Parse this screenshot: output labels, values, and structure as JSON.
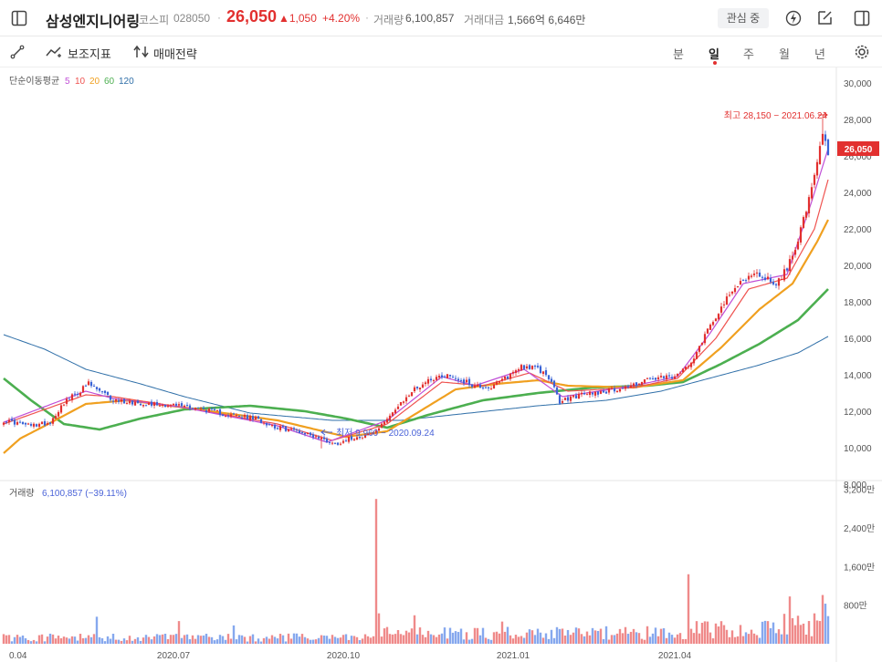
{
  "header": {
    "stock_name": "삼성엔지니어링",
    "market": "코스피",
    "code": "028050",
    "price": "26,050",
    "change": "▲1,050",
    "change_pct": "+4.20%",
    "volume_label": "거래량",
    "volume_value": "6,100,857",
    "amount_label": "거래대금",
    "amount_value": "1,566억 6,646만",
    "watch_label": "관심 중",
    "up_color": "#e2302f"
  },
  "toolbar": {
    "indicator_label": "보조지표",
    "strategy_label": "매매전략",
    "periods": [
      "분",
      "일",
      "주",
      "월",
      "년"
    ],
    "active_period": "일"
  },
  "chart_data": {
    "type": "candlestick",
    "ma_label": "단순이동평균",
    "ma_periods": [
      {
        "label": "5",
        "color": "#c04fd6"
      },
      {
        "label": "10",
        "color": "#ef5350"
      },
      {
        "label": "20",
        "color": "#f0a020"
      },
      {
        "label": "60",
        "color": "#4caf50"
      },
      {
        "label": "120",
        "color": "#2f6fa8"
      }
    ],
    "price_axis": {
      "ylim": [
        7000,
        31000
      ],
      "ticks": [
        "30,000",
        "28,000",
        "26,000",
        "24,000",
        "22,000",
        "20,000",
        "18,000",
        "16,000",
        "14,000",
        "12,000",
        "10,000",
        "8,000"
      ],
      "tick_values": [
        30000,
        28000,
        26000,
        24000,
        22000,
        20000,
        18000,
        16000,
        14000,
        12000,
        10000,
        8000
      ]
    },
    "x_labels": [
      {
        "label": "0.04",
        "i": 2
      },
      {
        "label": "2020.07",
        "i": 62
      },
      {
        "label": "2020.10",
        "i": 124
      },
      {
        "label": "2021.01",
        "i": 186
      },
      {
        "label": "2021.04",
        "i": 245
      }
    ],
    "current_price_tag": "26,050",
    "current_price": 26050,
    "high_annotation": "최고 28,150 − 2021.06.24",
    "high": 28150,
    "low_annotation": "최저 9,960 − 2020.09.24",
    "low": 9960,
    "close_series": [
      [
        0,
        11500
      ],
      [
        10,
        11200
      ],
      [
        17,
        11400
      ],
      [
        22,
        12500
      ],
      [
        26,
        12900
      ],
      [
        31,
        13500
      ],
      [
        36,
        13000
      ],
      [
        40,
        12600
      ],
      [
        47,
        12500
      ],
      [
        55,
        12400
      ],
      [
        66,
        12300
      ],
      [
        76,
        12000
      ],
      [
        82,
        11800
      ],
      [
        92,
        11600
      ],
      [
        100,
        11100
      ],
      [
        108,
        10900
      ],
      [
        116,
        10500
      ],
      [
        121,
        10200
      ],
      [
        126,
        10500
      ],
      [
        135,
        10800
      ],
      [
        138,
        11200
      ],
      [
        140,
        11700
      ],
      [
        144,
        12200
      ],
      [
        149,
        13100
      ],
      [
        156,
        13800
      ],
      [
        162,
        14000
      ],
      [
        167,
        13700
      ],
      [
        172,
        13400
      ],
      [
        178,
        13300
      ],
      [
        184,
        13900
      ],
      [
        189,
        14500
      ],
      [
        195,
        14300
      ],
      [
        199,
        13900
      ],
      [
        203,
        12500
      ],
      [
        208,
        12800
      ],
      [
        214,
        13000
      ],
      [
        220,
        13100
      ],
      [
        229,
        13400
      ],
      [
        234,
        13700
      ],
      [
        240,
        13800
      ],
      [
        246,
        13900
      ],
      [
        252,
        15000
      ],
      [
        257,
        16500
      ],
      [
        261,
        17500
      ],
      [
        265,
        18300
      ],
      [
        270,
        19300
      ],
      [
        276,
        19500
      ],
      [
        282,
        19000
      ],
      [
        286,
        19800
      ],
      [
        290,
        21500
      ],
      [
        294,
        23500
      ],
      [
        297,
        25500
      ],
      [
        299,
        27200
      ],
      [
        301,
        26050
      ]
    ],
    "ma_series": {
      "5": [
        [
          0,
          11400
        ],
        [
          30,
          13100
        ],
        [
          40,
          12700
        ],
        [
          66,
          12200
        ],
        [
          100,
          11200
        ],
        [
          118,
          10300
        ],
        [
          140,
          11500
        ],
        [
          160,
          13900
        ],
        [
          172,
          13400
        ],
        [
          190,
          14300
        ],
        [
          204,
          12800
        ],
        [
          230,
          13400
        ],
        [
          246,
          13900
        ],
        [
          258,
          16300
        ],
        [
          270,
          19000
        ],
        [
          286,
          19500
        ],
        [
          295,
          23500
        ],
        [
          301,
          26400
        ]
      ],
      "10": [
        [
          0,
          11300
        ],
        [
          30,
          12900
        ],
        [
          40,
          12800
        ],
        [
          66,
          12200
        ],
        [
          100,
          11300
        ],
        [
          120,
          10400
        ],
        [
          140,
          11300
        ],
        [
          160,
          13600
        ],
        [
          175,
          13400
        ],
        [
          192,
          14100
        ],
        [
          206,
          13100
        ],
        [
          230,
          13300
        ],
        [
          246,
          13800
        ],
        [
          260,
          16000
        ],
        [
          272,
          18700
        ],
        [
          286,
          19300
        ],
        [
          296,
          22000
        ],
        [
          301,
          24700
        ]
      ],
      "20": [
        [
          0,
          9700
        ],
        [
          6,
          10500
        ],
        [
          15,
          11200
        ],
        [
          30,
          12400
        ],
        [
          45,
          12600
        ],
        [
          66,
          12200
        ],
        [
          100,
          11500
        ],
        [
          125,
          10600
        ],
        [
          140,
          10900
        ],
        [
          165,
          13200
        ],
        [
          180,
          13500
        ],
        [
          195,
          13700
        ],
        [
          206,
          13400
        ],
        [
          230,
          13300
        ],
        [
          248,
          13700
        ],
        [
          262,
          15500
        ],
        [
          276,
          17600
        ],
        [
          288,
          19000
        ],
        [
          297,
          21300
        ],
        [
          301,
          22500
        ]
      ],
      "60": [
        [
          0,
          13800
        ],
        [
          10,
          12600
        ],
        [
          22,
          11300
        ],
        [
          35,
          11000
        ],
        [
          50,
          11600
        ],
        [
          66,
          12100
        ],
        [
          90,
          12300
        ],
        [
          110,
          12000
        ],
        [
          125,
          11600
        ],
        [
          140,
          11100
        ],
        [
          155,
          11800
        ],
        [
          175,
          12600
        ],
        [
          195,
          13000
        ],
        [
          215,
          13300
        ],
        [
          235,
          13400
        ],
        [
          248,
          13600
        ],
        [
          262,
          14600
        ],
        [
          276,
          15700
        ],
        [
          290,
          17000
        ],
        [
          301,
          18700
        ]
      ],
      "120": [
        [
          0,
          16200
        ],
        [
          15,
          15400
        ],
        [
          30,
          14300
        ],
        [
          50,
          13500
        ],
        [
          66,
          12800
        ],
        [
          90,
          11900
        ],
        [
          120,
          11500
        ],
        [
          145,
          11500
        ],
        [
          170,
          11900
        ],
        [
          195,
          12300
        ],
        [
          220,
          12600
        ],
        [
          240,
          13100
        ],
        [
          255,
          13700
        ],
        [
          275,
          14500
        ],
        [
          290,
          15200
        ],
        [
          301,
          16100
        ]
      ]
    },
    "volume": {
      "label": "거래량",
      "value": "6,100,857 (−39.11%)",
      "ylim": [
        0,
        3400
      ],
      "unit": "만",
      "ticks": [
        "3,200만",
        "2,400만",
        "1,600만",
        "800만"
      ],
      "tick_values": [
        3200,
        2400,
        1600,
        800
      ],
      "spikes": [
        {
          "i": 34,
          "v": 560
        },
        {
          "i": 64,
          "v": 470
        },
        {
          "i": 84,
          "v": 380
        },
        {
          "i": 136,
          "v": 3000
        },
        {
          "i": 137,
          "v": 630
        },
        {
          "i": 150,
          "v": 590
        },
        {
          "i": 182,
          "v": 460
        },
        {
          "i": 250,
          "v": 1440
        },
        {
          "i": 285,
          "v": 620
        },
        {
          "i": 287,
          "v": 980
        },
        {
          "i": 296,
          "v": 630
        },
        {
          "i": 299,
          "v": 1010
        },
        {
          "i": 300,
          "v": 830
        }
      ]
    }
  }
}
